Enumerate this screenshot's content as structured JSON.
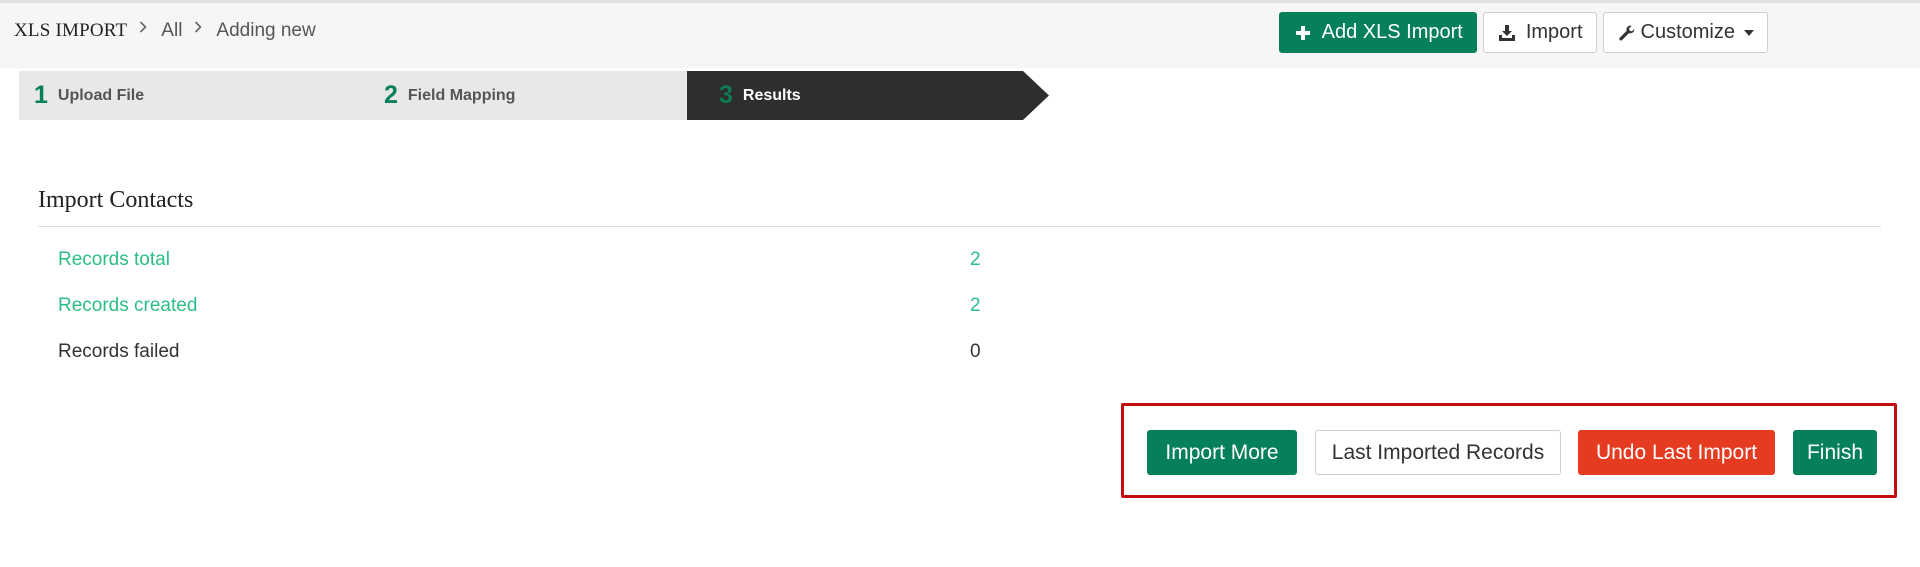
{
  "header": {
    "breadcrumb": [
      {
        "label": "XLS IMPORT"
      },
      {
        "label": "All"
      },
      {
        "label": "Adding new"
      }
    ],
    "toolbar": {
      "add_label": "Add XLS Import",
      "add_icon": "plus-icon",
      "import_label": "Import",
      "import_icon": "download-icon",
      "customize_label": "Customize",
      "customize_icon": "wrench-icon"
    }
  },
  "steps": [
    {
      "number": "1",
      "label": "Upload File",
      "state": "inactive"
    },
    {
      "number": "2",
      "label": "Field Mapping",
      "state": "inactive"
    },
    {
      "number": "3",
      "label": "Results",
      "state": "active"
    }
  ],
  "section": {
    "title": "Import Contacts"
  },
  "stats": [
    {
      "label": "Records total",
      "value": "2"
    },
    {
      "label": "Records created",
      "value": "2"
    },
    {
      "label": "Records failed",
      "value": "0"
    }
  ],
  "actions": {
    "import_more": "Import More",
    "last_imported": "Last Imported Records",
    "undo_last": "Undo Last Import",
    "finish": "Finish"
  },
  "colors": {
    "primary": "#06805a",
    "danger": "#e53b21",
    "link_green": "#2bbf85",
    "step_active_bg": "#2e2e2e",
    "highlight": "#c40d0d"
  }
}
